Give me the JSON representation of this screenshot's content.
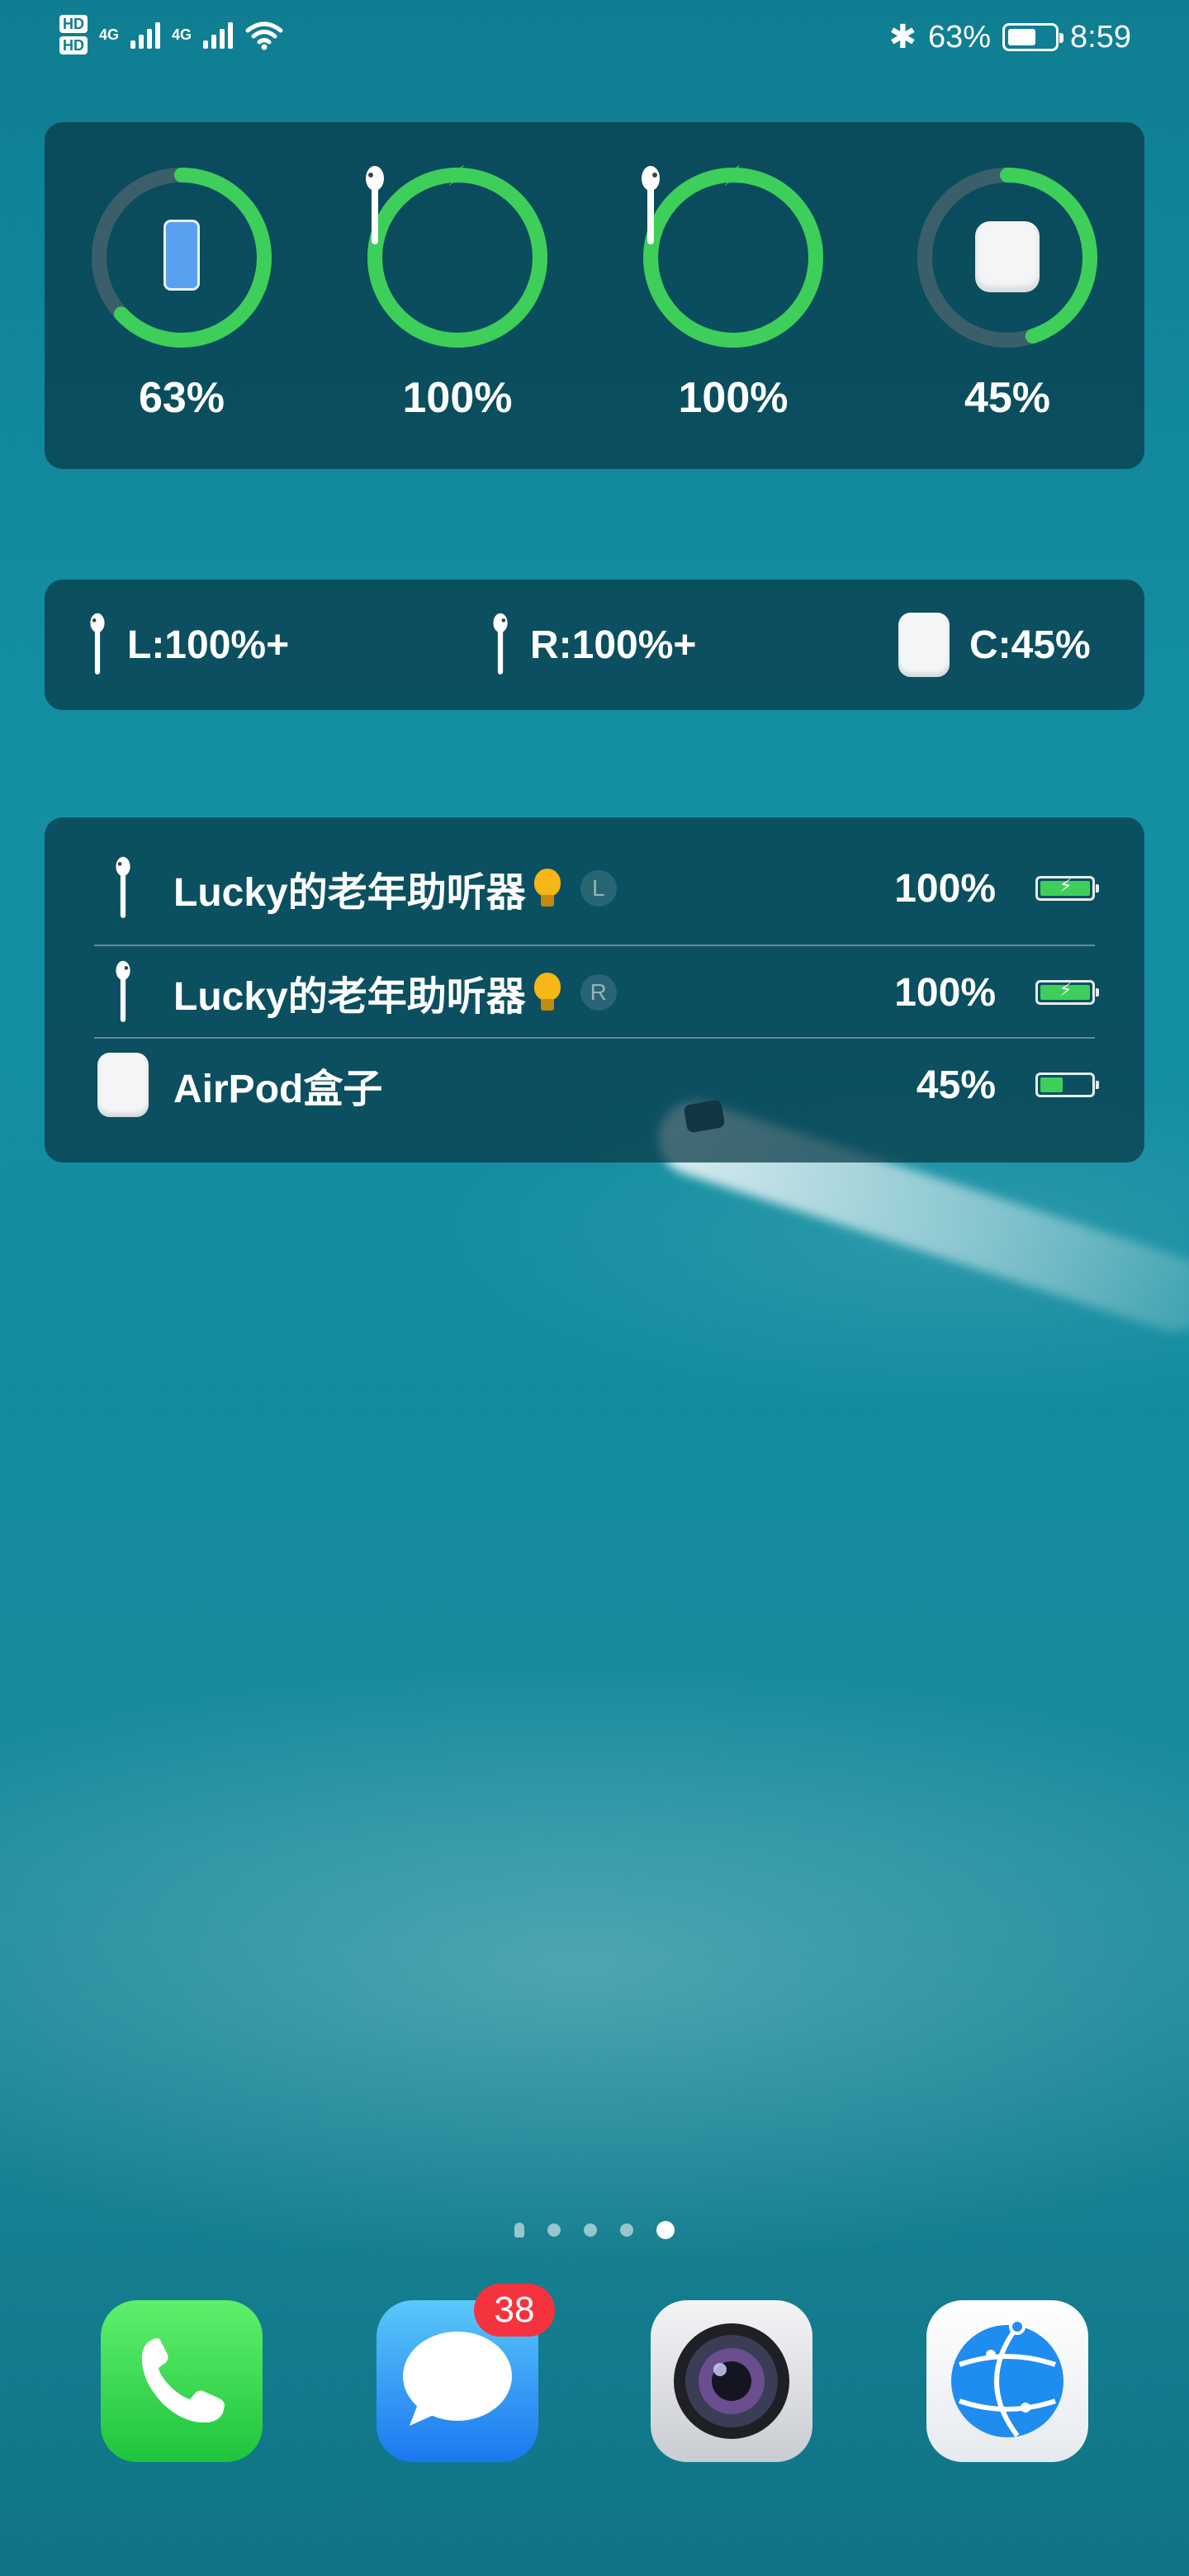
{
  "status_bar": {
    "hd1": "HD",
    "hd2": "HD",
    "net1": "4G",
    "net2": "4G",
    "bluetooth": "✱",
    "battery_percent": "63%",
    "battery_level": 0.63,
    "time": "8:59"
  },
  "ring_widget": {
    "items": [
      {
        "device": "phone",
        "icon": "phone-icon",
        "percent_label": "63%",
        "level": 0.63,
        "charging": false
      },
      {
        "device": "left-airpod",
        "icon": "airpod-left-icon",
        "percent_label": "100%",
        "level": 1.0,
        "charging": true
      },
      {
        "device": "right-airpod",
        "icon": "airpod-right-icon",
        "percent_label": "100%",
        "level": 1.0,
        "charging": true
      },
      {
        "device": "case",
        "icon": "airpods-case-icon",
        "percent_label": "45%",
        "level": 0.45,
        "charging": false
      }
    ],
    "ring_color": "#3dcf5a",
    "track_color": "#3b5f6a"
  },
  "text_widget": {
    "left": "L:100%+",
    "right": "R:100%+",
    "case": "C:45%"
  },
  "list_widget": {
    "rows": [
      {
        "name": "Lucky的老年助听器",
        "tag": "L",
        "percent": "100%",
        "level": 1.0,
        "charging": true
      },
      {
        "name": "Lucky的老年助听器",
        "tag": "R",
        "percent": "100%",
        "level": 1.0,
        "charging": true
      },
      {
        "name": "AirPod盒子",
        "tag": "",
        "percent": "45%",
        "level": 0.45,
        "charging": false
      }
    ]
  },
  "page_indicator": {
    "count": 5,
    "active_index": 4
  },
  "dock": {
    "apps": [
      {
        "name": "Phone",
        "icon": "phone-handset-icon"
      },
      {
        "name": "Messages",
        "icon": "speech-bubble-icon",
        "badge": "38"
      },
      {
        "name": "Camera",
        "icon": "camera-lens-icon"
      },
      {
        "name": "Browser",
        "icon": "globe-icon"
      }
    ]
  }
}
